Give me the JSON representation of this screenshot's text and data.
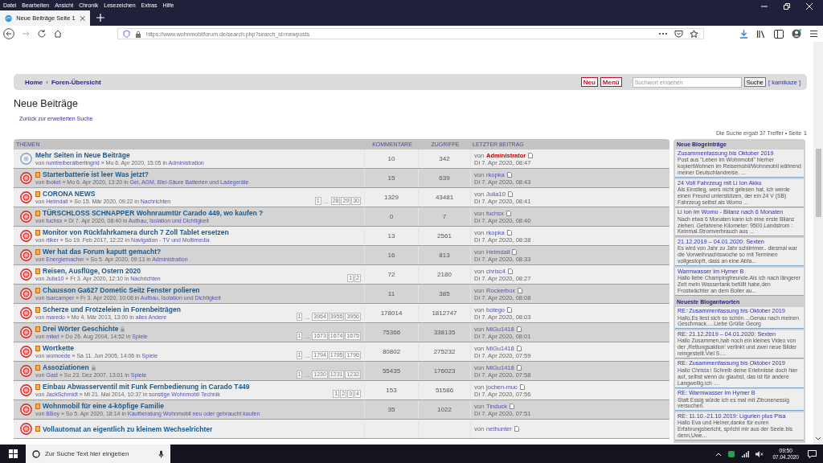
{
  "browser": {
    "menu": [
      "Datei",
      "Bearbeiten",
      "Ansicht",
      "Chronik",
      "Lesezeichen",
      "Extras",
      "Hilfe"
    ],
    "tabs": [
      {
        "label": "Neue Beiträge Seite 1",
        "selected": true
      }
    ],
    "url": "https://www.wohnmobilforum.de/search.php?search_id=newposts"
  },
  "navbar": {
    "breadcrumbs": [
      "Home",
      "Foren-Übersicht"
    ],
    "separator": "‹",
    "buttons": [
      "Neu",
      "Menü"
    ],
    "search": {
      "placeholder": "Suchwort eingeben",
      "button": "Suche"
    },
    "user": "[ kamikaze ]"
  },
  "page": {
    "title": "Neue Beiträge",
    "back_link": "Zurück zur erweiterten Suche",
    "result": "Die Suche ergab 37 Treffer • Seite",
    "page": "1"
  },
  "topics": {
    "columns": [
      "THEMEN",
      "KOMMENTARE",
      "ZUGRIFFE",
      "LETZTER BEITRAG"
    ],
    "rows": [
      {
        "unread": false,
        "title": "Mehr Seiten in Neue Beiträge",
        "locked": false,
        "by": "von",
        "author": "rumtreiberalbertingrid",
        "meta": "» Mo 6. Apr 2020, 15:05 in",
        "forum": "Administration",
        "comments": "10",
        "views": "342",
        "last_by": "von",
        "last_author": "Administrator",
        "author_highlight": true,
        "last_date": "Di 7. Apr 2020, 08:47"
      },
      {
        "unread": true,
        "title": "Starterbatterie ist leer Was jetzt?",
        "locked": false,
        "by": "von",
        "author": "lbokel",
        "meta": "» Mo 6. Apr 2020, 13:20 in",
        "forum": "Gel, AGM, Blei-Säure Batterien und Ladegeräte",
        "comments": "15",
        "views": "639",
        "last_by": "von",
        "last_author": "rkopka",
        "author_highlight": false,
        "last_date": "Di 7. Apr 2020, 08:43"
      },
      {
        "unread": true,
        "title": "CORONA NEWS",
        "locked": false,
        "by": "von",
        "author": "Heimdall",
        "meta": "» So 15. Mär 2020, 09:22 in",
        "forum": "Nachrichten",
        "pages": [
          {
            "kind": "page",
            "label": "1"
          },
          {
            "kind": "gap",
            "label": "..."
          },
          {
            "kind": "page",
            "label": "28"
          },
          {
            "kind": "page",
            "label": "29"
          },
          {
            "kind": "page",
            "label": "30"
          }
        ],
        "comments": "1329",
        "views": "43481",
        "last_by": "von",
        "last_author": "Julia10",
        "author_highlight": false,
        "last_date": "Di 7. Apr 2020, 08:41"
      },
      {
        "unread": true,
        "title": "TÜRSCHLOSS SCHNAPPER Wohnraumtür Carado 449, wo kaufen ?",
        "locked": false,
        "by": "von",
        "author": "fuchsx",
        "meta": "» Di 7. Apr 2020, 08:40 in",
        "forum": "Aufbau, Isolation und Dichtigkeit",
        "comments": "0",
        "views": "7",
        "last_by": "von",
        "last_author": "fuchsx",
        "author_highlight": false,
        "last_date": "Di 7. Apr 2020, 08:40"
      },
      {
        "unread": true,
        "title": "Monitor von Rückfahrkamera durch 7 Zoll Tablet ersetzen",
        "locked": false,
        "by": "von",
        "author": "rtiker",
        "meta": "» So 19. Feb 2017, 12:22 in",
        "forum": "Navigation - TV und Multimedia",
        "comments": "13",
        "views": "2561",
        "last_by": "von",
        "last_author": "rkopka",
        "author_highlight": false,
        "last_date": "Di 7. Apr 2020, 08:38"
      },
      {
        "unread": true,
        "title": "Wer hat das Forum kaputt gemacht?",
        "locked": false,
        "by": "von",
        "author": "Energiemacher",
        "meta": "» So 5. Apr 2020, 09:13 in",
        "forum": "Administration",
        "comments": "16",
        "views": "813",
        "last_by": "von",
        "last_author": "Heimdall",
        "author_highlight": false,
        "last_date": "Di 7. Apr 2020, 08:33"
      },
      {
        "unread": true,
        "title": "Reisen, Ausflüge, Ostern 2020",
        "locked": false,
        "by": "von",
        "author": "Julia10",
        "meta": "» Fr 3. Apr 2020, 12:10 in",
        "forum": "Nachrichten",
        "pages": [
          {
            "kind": "page",
            "label": "1"
          },
          {
            "kind": "page",
            "label": "2"
          }
        ],
        "comments": "72",
        "views": "2180",
        "last_by": "von",
        "last_author": "chrisc4",
        "author_highlight": false,
        "last_date": "Di 7. Apr 2020, 08:27"
      },
      {
        "unread": true,
        "title": "Chausson Ga627 Dometic Seitz Fenster polieren",
        "locked": false,
        "by": "von",
        "author": "Isarcamper",
        "meta": "» Fr 3. Apr 2020, 10:08 in",
        "forum": "Aufbau, Isolation und Dichtigkeit",
        "comments": "11",
        "views": "385",
        "last_by": "von",
        "last_author": "Rockerbox",
        "author_highlight": false,
        "last_date": "Di 7. Apr 2020, 08:08"
      },
      {
        "unread": true,
        "title": "Scherze und Frotzeleien in Forenbeiträgen",
        "locked": false,
        "by": "von",
        "author": "maredo",
        "meta": "» Mo 4. Mär 2013, 13:00 in",
        "forum": "alles Andere",
        "pages": [
          {
            "kind": "page",
            "label": "1"
          },
          {
            "kind": "gap",
            "label": "..."
          },
          {
            "kind": "page",
            "label": "3954"
          },
          {
            "kind": "page",
            "label": "3955"
          },
          {
            "kind": "page",
            "label": "3956"
          }
        ],
        "comments": "178014",
        "views": "1812747",
        "last_by": "von",
        "last_author": "botego",
        "author_highlight": false,
        "last_date": "Di 7. Apr 2020, 08:03"
      },
      {
        "unread": true,
        "title": "Drei Wörter Geschichte",
        "locked": true,
        "by": "von",
        "author": "mikel",
        "meta": "» Do 26. Aug 2004, 14:52 in",
        "forum": "Spiele",
        "pages": [
          {
            "kind": "page",
            "label": "1"
          },
          {
            "kind": "gap",
            "label": "..."
          },
          {
            "kind": "page",
            "label": "1673"
          },
          {
            "kind": "page",
            "label": "1674"
          },
          {
            "kind": "page",
            "label": "1675"
          }
        ],
        "comments": "75366",
        "views": "338135",
        "last_by": "von",
        "last_author": "MiGu1418",
        "author_highlight": false,
        "last_date": "Di 7. Apr 2020, 08:01"
      },
      {
        "unread": true,
        "title": "Wortkette",
        "locked": false,
        "by": "von",
        "author": "womoede",
        "meta": "» Sa 11. Jun 2005, 14:06 in",
        "forum": "Spiele",
        "pages": [
          {
            "kind": "page",
            "label": "1"
          },
          {
            "kind": "gap",
            "label": "..."
          },
          {
            "kind": "page",
            "label": "1794"
          },
          {
            "kind": "page",
            "label": "1795"
          },
          {
            "kind": "page",
            "label": "1796"
          }
        ],
        "comments": "80802",
        "views": "275232",
        "last_by": "von",
        "last_author": "MiGu1418",
        "author_highlight": false,
        "last_date": "Di 7. Apr 2020, 07:59"
      },
      {
        "unread": true,
        "title": "Assoziationen",
        "locked": true,
        "by": "von",
        "author": "Gast",
        "meta": "» So 23. Dez 2007, 13:01 in",
        "forum": "Spiele",
        "pages": [
          {
            "kind": "page",
            "label": "1"
          },
          {
            "kind": "gap",
            "label": "..."
          },
          {
            "kind": "page",
            "label": "1230"
          },
          {
            "kind": "page",
            "label": "1231"
          },
          {
            "kind": "page",
            "label": "1232"
          }
        ],
        "comments": "55435",
        "views": "176023",
        "last_by": "von",
        "last_author": "MiGu1418",
        "author_highlight": false,
        "last_date": "Di 7. Apr 2020, 07:58"
      },
      {
        "unread": true,
        "title": "Einbau Abwasserventil mit Funk Fernbedienung in Carado T449",
        "locked": false,
        "by": "von",
        "author": "JackSchmidt",
        "meta": "» Mi 21. Mai 2014, 10:37 in",
        "forum": "sonstige Wohnmobil Technik",
        "pages": [
          {
            "kind": "page",
            "label": "1"
          },
          {
            "kind": "page",
            "label": "2"
          },
          {
            "kind": "page",
            "label": "3"
          },
          {
            "kind": "page",
            "label": "4"
          }
        ],
        "comments": "153",
        "views": "51586",
        "last_by": "von",
        "last_author": "jochen-muc",
        "author_highlight": false,
        "last_date": "Di 7. Apr 2020, 07:56"
      },
      {
        "unread": true,
        "title": "Wohnmobil für eine 4-köpfige Familie",
        "locked": false,
        "by": "von",
        "author": "BBoy",
        "meta": "» So 5. Apr 2020, 18:14 in",
        "forum": "Kaufberatung Wohnmobil neu oder gebraucht kaufen",
        "comments": "35",
        "views": "1022",
        "last_by": "von",
        "last_author": "Tinduck",
        "author_highlight": false,
        "last_date": "Di 7. Apr 2020, 07:51"
      },
      {
        "unread": true,
        "title": "Vollautomat an eigentlich zu kleinem Wechselrichter",
        "locked": false,
        "last_by": "von",
        "last_author": "nethunter",
        "author_highlight": false
      }
    ]
  },
  "sidebar": {
    "sections": [
      {
        "title": "Neue Blogeinträge",
        "entries": [
          {
            "title": "Zusammenfassung bis Oktober 2019",
            "text": "Post aus \"Leben im Wohnmobil\" hierher kopiertWohnen im Reisemobil/Wohnmobil während meiner Deutschlandreise. ..."
          },
          {
            "title": "24 Volt Fahrzeug mit Li Ion Akku",
            "text": "Als Einstieg, wers nicht gelesen hat, ich werde einen Freund unterstützen, der ein 24 V (SB) Fahrzeug selbst als Womo ..."
          },
          {
            "title": "Li Ion im Womo - Bilanz nach 6 Monaten",
            "text": "Nach etwa 6 Monaten kann ich eine erste Bilanz ziehen. Gefahrene Kilometer: 9500.Landstrom : Keinmal.Stromverbrauch aus ..."
          },
          {
            "title": "21.12.2019 – 04.01.2020: Sexten",
            "text": "Es wird von Jahr zu Jahr schlimmer.. diesmal war die Vorweihnachtswoche so mit Terminen vollgestopft, dass an eine Abfa..."
          },
          {
            "title": "Warmwasser im Hymer B",
            "text": "Hallo liebe Champingfreunde.Als ich nach längerer Zeit mein Wassertank befüllt habe,den Frostwächter an dem Boiler au..."
          }
        ]
      },
      {
        "title": "Neueste Blogantworten",
        "entries": [
          {
            "title": "RE: Zusammenfassung bis Oktober 2019",
            "text": "Hallo,Es liest sich so schön....Genau nach meinen Geschmack.....Liebe Grüße Georg"
          },
          {
            "title": "RE: 21.12.2019 – 04.01.2020: Sexten",
            "text": "Hallo Zusammen,hab noch ein kleines Video von der ‚Rettungsaktion' verlinkt und zwei neue Bilder reingestellt.Viel S...."
          },
          {
            "title": "RE: Zusammenfassung bis Oktober 2019",
            "text": "Hallo Christa ! Schreib deine Erlebnisse doch hier auf, selbst wenn du glaubst, das ist für andere Langweilig.ich ...."
          },
          {
            "title": "RE: Warmwasser im Hymer B",
            "text": "Statt Essig würde ich es mal mit Zitronenessig versuchen."
          },
          {
            "title": "RE: 11.10.-21.10.2019: Ligurien plus Pisa",
            "text": "Hallo Eva und Heiner,danke für euren Erfahrungsbericht, spricht mir aus der Seele.bis denn,Uwe..."
          }
        ]
      }
    ]
  },
  "taskbar": {
    "search_placeholder": "Zur Suche Text hier eingeben",
    "time": "09:50",
    "date": "07.04.2020"
  }
}
